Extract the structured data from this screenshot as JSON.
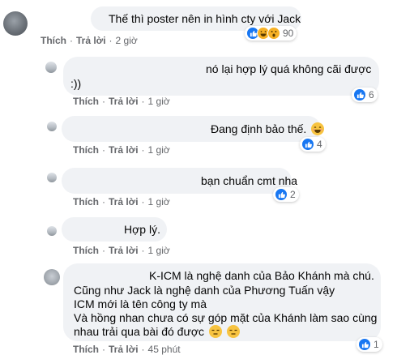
{
  "comments": [
    {
      "text_lines": [
        "Thế thì poster nên in hình cty với Jack"
      ],
      "actions": {
        "like": "Thích",
        "reply": "Trả lời",
        "time": "2 giờ"
      },
      "reactions": {
        "count": "90",
        "types": [
          "like-icon",
          "haha-icon",
          "wow-icon"
        ]
      }
    },
    {
      "text_lines": [
        "nó lại hợp lý quá không cãi được",
        ":))"
      ],
      "actions": {
        "like": "Thích",
        "reply": "Trả lời",
        "time": "1 giờ"
      },
      "reactions": {
        "count": "6",
        "types": [
          "like-icon"
        ]
      }
    },
    {
      "text_lines": [
        "Đang định bảo thế."
      ],
      "emoji": "smile-emoji",
      "actions": {
        "like": "Thích",
        "reply": "Trả lời",
        "time": "1 giờ"
      },
      "reactions": {
        "count": "4",
        "types": [
          "like-icon"
        ]
      }
    },
    {
      "text_lines": [
        "bạn chuẩn cmt nha"
      ],
      "actions": {
        "like": "Thích",
        "reply": "Trả lời",
        "time": "1 giờ"
      },
      "reactions": {
        "count": "2",
        "types": [
          "like-icon"
        ]
      }
    },
    {
      "text_lines": [
        "Hợp lý."
      ],
      "actions": {
        "like": "Thích",
        "reply": "Trả lời",
        "time": "1 giờ"
      }
    },
    {
      "text_lines": [
        "K-ICM là nghệ danh của Bảo Khánh mà chú.",
        "Cũng như Jack là nghệ danh của Phương Tuấn vậy",
        "ICM mới là tên công ty mà",
        "Và hồng nhan chưa có sự góp mặt của Khánh làm sao cùng",
        "nhau trải qua bài đó được"
      ],
      "emoji": "expressionless-emoji",
      "actions": {
        "like": "Thích",
        "reply": "Trả lời",
        "time": "45 phút"
      },
      "reactions": {
        "count": "1",
        "types": [
          "like-icon"
        ]
      }
    }
  ],
  "separator": "·",
  "colors": {
    "bubble": "#f0f2f5",
    "meta": "#65676b",
    "like": "#1877f2",
    "emoji": "#f7c340"
  }
}
